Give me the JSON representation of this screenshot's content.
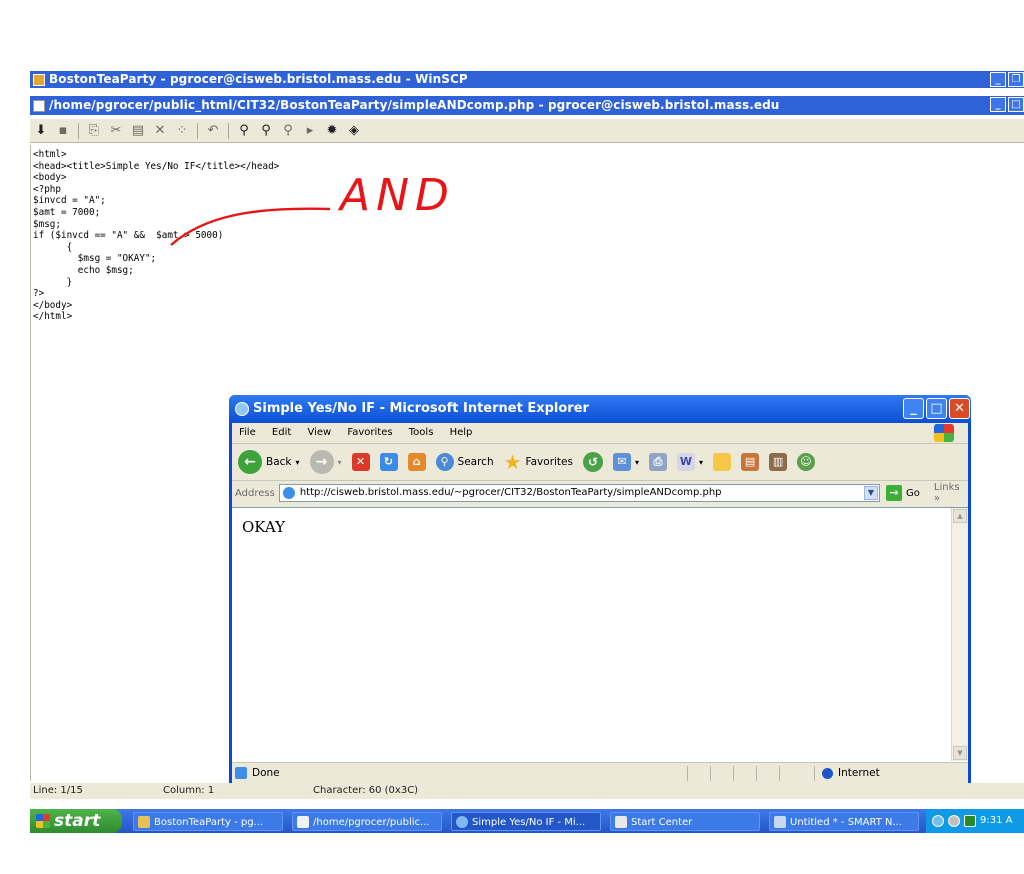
{
  "winscp": {
    "title": "BostonTeaParty - pgrocer@cisweb.bristol.mass.edu - WinSCP",
    "editor_title": "/home/pgrocer/public_html/CIT32/BostonTeaParty/simpleANDcomp.php - pgrocer@cisweb.bristol.mass.edu"
  },
  "code_lines": [
    "<html>",
    "<head><title>Simple Yes/No IF</title></head>",
    "<body>",
    "<?php",
    "$invcd = \"A\";",
    "$amt = 7000;",
    "$msg;",
    "if ($invcd == \"A\" &&  $amt > 5000)",
    "      {",
    "        $msg = \"OKAY\";",
    "        echo $msg;",
    "      }",
    "?>",
    "</body>",
    "</html>"
  ],
  "annotation": "AND",
  "status": {
    "line": "Line: 1/15",
    "column": "Column: 1",
    "character": "Character: 60 (0x3C)"
  },
  "ie": {
    "title": "Simple Yes/No IF - Microsoft Internet Explorer",
    "menu": [
      "File",
      "Edit",
      "View",
      "Favorites",
      "Tools",
      "Help"
    ],
    "toolbar": {
      "back": "Back",
      "search": "Search",
      "favorites": "Favorites"
    },
    "address_label": "Address",
    "url": "http://cisweb.bristol.mass.edu/~pgrocer/CIT32/BostonTeaParty/simpleANDcomp.php",
    "go": "Go",
    "links": "Links",
    "page_text": "OKAY",
    "status_done": "Done",
    "status_zone": "Internet"
  },
  "taskbar": {
    "start": "start",
    "items": [
      "BostonTeaParty - pg...",
      "/home/pgrocer/public...",
      "Simple Yes/No IF - Mi...",
      "Start Center",
      "Untitled * - SMART N..."
    ],
    "clock": "9:31 A"
  }
}
